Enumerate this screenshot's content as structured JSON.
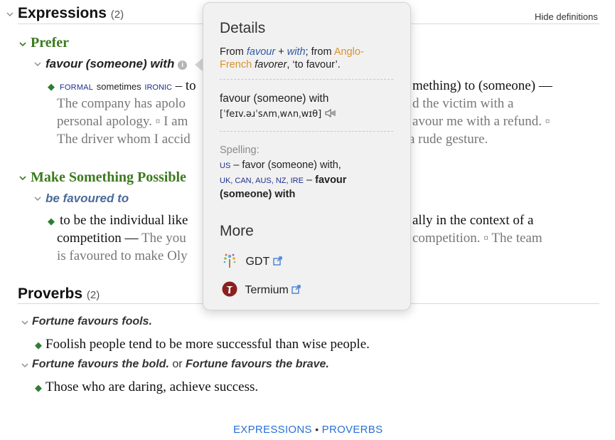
{
  "expressions": {
    "heading": "Expressions",
    "count": "(2)",
    "hide_label": "Hide definitions",
    "senses": [
      {
        "title": "Prefer",
        "phrase": "favour (someone) with",
        "def": {
          "label_formal": "FORMAL",
          "label_sometimes": "sometimes",
          "label_ironic": "IRONIC",
          "line1_a": "– to",
          "line1_b": "mething) to (someone) —",
          "line2_a": "The company has apolo",
          "line2_b": "d the victim with a",
          "line3_a": "personal apology. ▫ I am",
          "line3_b": "avour me with a refund. ▫",
          "line4_a": "The driver whom I accid",
          "line4_b": "a rude gesture."
        }
      },
      {
        "title": "Make Something Possible",
        "phrase": "be favoured to",
        "def": {
          "line1_a": "to be the individual like",
          "line1_b": "ally in the context of a",
          "line2_a": "competition —",
          "line2_ex": "The you",
          "line2_b": "competition. ▫ The team",
          "line3_a": "is favoured to make Oly"
        }
      }
    ]
  },
  "proverbs": {
    "heading": "Proverbs",
    "count": "(2)",
    "items": [
      {
        "text": "Fortune favours fools.",
        "def": "Foolish people tend to be more successful than wise people."
      },
      {
        "text": "Fortune favours the bold.",
        "or": "or",
        "alt": "Fortune favours the brave.",
        "def": "Those who are daring, achieve success."
      }
    ]
  },
  "popover": {
    "details_heading": "Details",
    "etym_from": "From",
    "etym_favour": "favour",
    "etym_plus": "+",
    "etym_with": "with",
    "etym_from2": "; from",
    "etym_anglo": "Anglo-",
    "etym_french": "French",
    "etym_favorer": "favorer",
    "etym_tail": ", ‘to favour’.",
    "pron_phrase": "favour (someone) with",
    "pron_ipa": "[ˈfeɪv.əɹˈsʌmˌwʌnˌwɪθ]",
    "spelling_label": "Spelling:",
    "spelling_us": "US",
    "spelling_us_text": "– favor (someone) with,",
    "spelling_regions": "UK, CAN, AUS, NZ, IRE",
    "spelling_dash": "–",
    "spelling_bold_1": "favour",
    "spelling_bold_2": "(someone) with",
    "more_heading": "More",
    "more_items": [
      {
        "label": "GDT",
        "icon": "gdt-tree-icon"
      },
      {
        "label": "Termium",
        "icon": "termium-icon"
      }
    ]
  },
  "footer": {
    "expressions": "EXPRESSIONS",
    "sep": "•",
    "proverbs": "PROVERBS"
  },
  "colors": {
    "sense_green": "#3c7a1f",
    "link_blue": "#2a6fd6",
    "label_navy": "#1f2f8c",
    "etym_orange": "#d9922e"
  }
}
